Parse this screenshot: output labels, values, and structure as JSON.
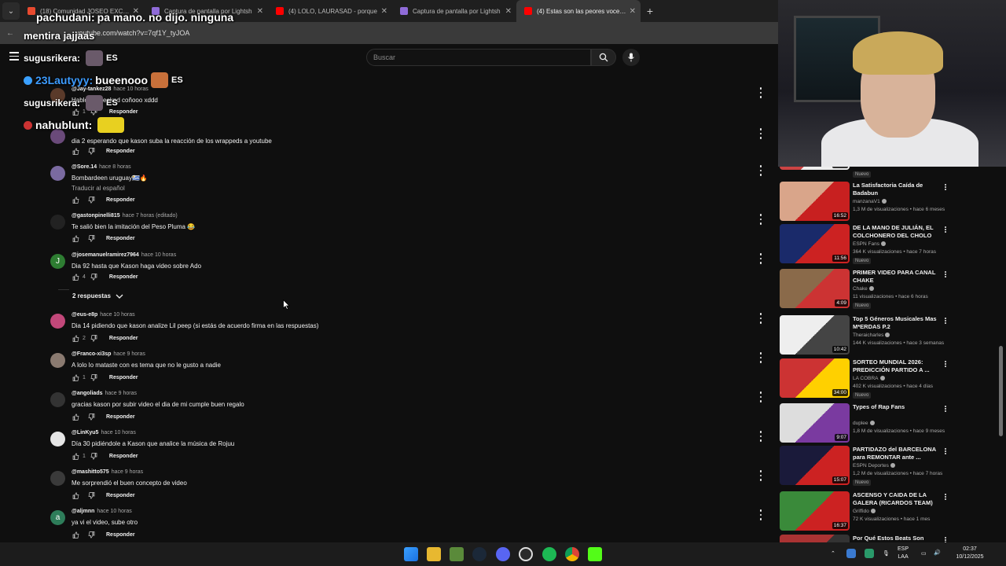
{
  "browser": {
    "tabs": [
      {
        "title": "(18) Comunidad JOSEO EXCLUS",
        "color": "#e84a2f"
      },
      {
        "title": "Captura de pantalla por Lightsh",
        "color": "#8f6bd8"
      },
      {
        "title": "(4) LOLO, LAURASAD - porque",
        "color": "#ff0000"
      },
      {
        "title": "Captura de pantalla por Lightsh",
        "color": "#8f6bd8"
      },
      {
        "title": "(4) Estas son las peores voces d",
        "color": "#ff0000"
      }
    ],
    "url": "youtube.com/watch?v=7qf1Y_tyJOA"
  },
  "youtube": {
    "search_placeholder": "Buscar"
  },
  "chat": [
    {
      "user": "pachudani:",
      "text": "pa mano. no dijo. ninguna",
      "color": "#ffffff"
    },
    {
      "user": "",
      "text": "mentira jajjaas",
      "color": "#ffffff"
    },
    {
      "user": "sugusrikera:",
      "text": "ES",
      "color": "#ffffff"
    },
    {
      "user": "23Lautyyy:",
      "text": "bueenooo",
      "extra": "ES",
      "color": "#3d9cff"
    },
    {
      "user": "sugusrikera:",
      "text": "ES",
      "color": "#ffffff"
    },
    {
      "user": "nahublunt:",
      "text": "",
      "color": "#ffffff"
    }
  ],
  "comments": [
    {
      "handle": "@Jay-tankez28",
      "time": "hace 10 horas",
      "text": "Hablo de weeknd coñooo xddd",
      "likes": "1",
      "reply": "Responder",
      "avatar_color": "#5a3a2a",
      "avatar_letter": ""
    },
    {
      "handle": "",
      "time": "",
      "text": "dia 2 esperando que kason suba la reacción de los wrappeds a youtube",
      "likes": "",
      "reply": "Responder",
      "avatar_color": "#6a4a7a",
      "avatar_letter": ""
    },
    {
      "handle": "@Sore.14",
      "time": "hace 8 horas",
      "text": "Bombardeen uruguay🇺🇾🔥",
      "translate": "Traducir al español",
      "likes": "",
      "reply": "Responder",
      "avatar_color": "#7a6aa0",
      "avatar_letter": ""
    },
    {
      "handle": "@gastonpinelli815",
      "time": "hace 7 horas (editado)",
      "text": "Te salió bien la imitación del Peso Pluma 😂",
      "likes": "",
      "reply": "Responder",
      "avatar_color": "#222222",
      "avatar_letter": ""
    },
    {
      "handle": "@josemanuelramirez7964",
      "time": "hace 10 horas",
      "text": "Dia 92 hasta que Kason haga video sobre Ado",
      "likes": "4",
      "reply": "Responder",
      "avatar_color": "#2e7d32",
      "avatar_letter": "J"
    },
    {
      "handle": "@eus-e8p",
      "time": "hace 10 horas",
      "text": "Dia 14 pidiendo que kason analize Lil peep (si estás de acuerdo firma en las respuestas)",
      "likes": "2",
      "reply": "Responder",
      "avatar_color": "#c2487a",
      "avatar_letter": ""
    },
    {
      "handle": "@Franco-xi3sp",
      "time": "hace 9 horas",
      "text": "A lolo lo mataste con es tema que no le gusto a nadie",
      "likes": "1",
      "reply": "Responder",
      "avatar_color": "#8a7a70",
      "avatar_letter": ""
    },
    {
      "handle": "@angoliads",
      "time": "hace 9 horas",
      "text": "gracias kason por subir video el dia de mi cumple buen regalo",
      "likes": "",
      "reply": "Responder",
      "avatar_color": "#333333",
      "avatar_letter": ""
    },
    {
      "handle": "@LinKyu5",
      "time": "hace 10 horas",
      "text": "Día 30 pidiéndole a Kason que analice la música de Rojuu",
      "likes": "1",
      "reply": "Responder",
      "avatar_color": "#e6e6e6",
      "avatar_letter": ""
    },
    {
      "handle": "@mashitto575",
      "time": "hace 9 horas",
      "text": "Me sorprendió el buen concepto de video",
      "likes": "",
      "reply": "Responder",
      "avatar_color": "#3a3a3a",
      "avatar_letter": ""
    },
    {
      "handle": "@aljmnn",
      "time": "hace 10 horas",
      "text": "ya vi el video, sube otro",
      "likes": "",
      "reply": "Responder",
      "avatar_color": "#2e7d5a",
      "avatar_letter": "a"
    }
  ],
  "replies_label": "2 respuestas",
  "recommendations": [
    {
      "title": "",
      "channel": "",
      "meta": "",
      "duration": "13:17",
      "badge": "Nuevo",
      "colors": [
        "#c44",
        "#eee"
      ]
    },
    {
      "title": "La Satisfactoria Caída de Badabun",
      "channel": "manzanaV1",
      "meta": "1,3 M de visualizaciones • hace 6 meses",
      "duration": "16:52",
      "badge": "",
      "colors": [
        "#d9a58a",
        "#c82020"
      ]
    },
    {
      "title": "DE LA MANO DE JULIÁN, EL COLCHONERO DEL CHOLO ...",
      "channel": "ESPN Fans",
      "meta": "364 K visualizaciones • hace 7 horas",
      "duration": "11:56",
      "badge": "Nuevo",
      "colors": [
        "#1a2a6a",
        "#c22"
      ]
    },
    {
      "title": "PRIMER VIDEO PARA CANAL CHAKE",
      "channel": "Chake",
      "meta": "11 visualizaciones • hace 6 horas",
      "duration": "4:09",
      "badge": "Nuevo",
      "colors": [
        "#8a6a4a",
        "#c33"
      ]
    },
    {
      "title": "Top 5 Géneros Musicales Mas M*ERDAS P.2",
      "channel": "Theraicharles",
      "meta": "144 K visualizaciones • hace 3 semanas",
      "duration": "10:42",
      "badge": "",
      "colors": [
        "#eee",
        "#444"
      ]
    },
    {
      "title": "SORTEO MUNDIAL 2026: PREDICCIÓN PARTIDO A ...",
      "channel": "LA COBRA",
      "meta": "402 K visualizaciones • hace 4 días",
      "duration": "34:00",
      "badge": "Nuevo",
      "colors": [
        "#c33",
        "#ffd000"
      ]
    },
    {
      "title": "Types of Rap Fans",
      "channel": "duplee",
      "meta": "1,8 M de visualizaciones • hace 9 meses",
      "duration": "9:07",
      "badge": "",
      "colors": [
        "#ddd",
        "#7a3aa0"
      ]
    },
    {
      "title": "PARTIDAZO del BARCELONA para REMONTAR ante ...",
      "channel": "ESPN Deportes",
      "meta": "1,2 M de visualizaciones • hace 7 horas",
      "duration": "15:07",
      "badge": "Nuevo",
      "colors": [
        "#1a1a3a",
        "#c22"
      ]
    },
    {
      "title": "ASCENSO Y CAIDA DE LA GALERA (RICARDOS TEAM)",
      "channel": "Griffido",
      "meta": "72 K visualizaciones • hace 1 mes",
      "duration": "16:37",
      "badge": "",
      "colors": [
        "#3a8a3a",
        "#c22"
      ]
    },
    {
      "title": "Por Qué Estos Beats Son",
      "channel": "",
      "meta": "",
      "duration": "",
      "badge": "",
      "colors": [
        "#a33",
        "#333"
      ]
    }
  ],
  "taskbar": {
    "lang_top": "ESP",
    "lang_bottom": "LAA",
    "time": "02:37",
    "date": "10/12/2025"
  }
}
